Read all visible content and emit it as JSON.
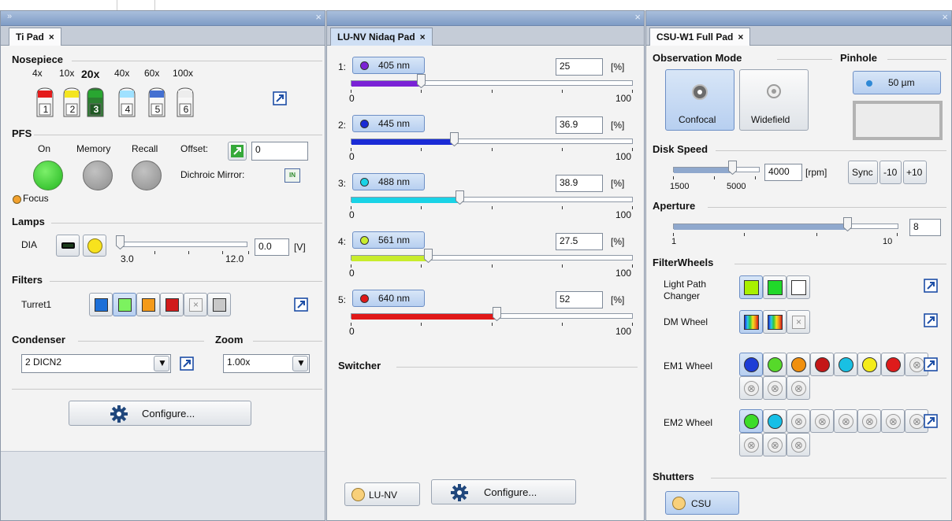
{
  "colors": {
    "header": "#7f9cc6",
    "accent": "#6d8fc5"
  },
  "ti": {
    "tab": "Ti Pad",
    "nosepiece": {
      "title": "Nosepiece",
      "mags": [
        "4x",
        "10x",
        "20x",
        "40x",
        "60x",
        "100x"
      ],
      "slots": [
        "1",
        "2",
        "3",
        "4",
        "5",
        "6"
      ],
      "active_index": 2
    },
    "pfs": {
      "title": "PFS",
      "on": "On",
      "memory": "Memory",
      "recall": "Recall",
      "offset_label": "Offset:",
      "offset_value": "0",
      "dichroic_label": "Dichroic Mirror:",
      "dichroic_badge": "IN",
      "focus": "Focus"
    },
    "lamps": {
      "title": "Lamps",
      "dia": "DIA",
      "min": "3.0",
      "max": "12.0",
      "value": "0.0",
      "unit": "[V]"
    },
    "filters": {
      "title": "Filters",
      "turret": "Turret1"
    },
    "condenser": {
      "title": "Condenser",
      "value": "2 DICN2"
    },
    "zoom": {
      "title": "Zoom",
      "value": "1.00x"
    },
    "configure": "Configure..."
  },
  "lunv": {
    "tab": "LU-NV Nidaq Pad",
    "channels": [
      {
        "idx": "1:",
        "label": "405 nm",
        "value": "25",
        "unit": "[%]",
        "pct": 25,
        "dot": "#7a22d6",
        "fill": "#7a22d6"
      },
      {
        "idx": "2:",
        "label": "445 nm",
        "value": "36.9",
        "unit": "[%]",
        "pct": 36.9,
        "dot": "#1a2bd6",
        "fill": "#1a2bd6"
      },
      {
        "idx": "3:",
        "label": "488 nm",
        "value": "38.9",
        "unit": "[%]",
        "pct": 38.9,
        "dot": "#19d3e6",
        "fill": "#19d3e6"
      },
      {
        "idx": "4:",
        "label": "561 nm",
        "value": "27.5",
        "unit": "[%]",
        "pct": 27.5,
        "dot": "#c8ec2c",
        "fill": "#c8ec2c"
      },
      {
        "idx": "5:",
        "label": "640 nm",
        "value": "52",
        "unit": "[%]",
        "pct": 52,
        "dot": "#e01818",
        "fill": "#e01818"
      }
    ],
    "min": "0",
    "max": "100",
    "switcher": "Switcher",
    "lunv_btn": "LU-NV",
    "configure": "Configure..."
  },
  "csu": {
    "tab": "CSU-W1 Full Pad",
    "observation": {
      "title": "Observation Mode",
      "confocal": "Confocal",
      "widefield": "Widefield"
    },
    "pinhole": {
      "title": "Pinhole",
      "value": "50 µm"
    },
    "disk": {
      "title": "Disk Speed",
      "min": "1500",
      "max": "5000",
      "value": "4000",
      "unit": "[rpm]",
      "sync": "Sync",
      "minus": "-10",
      "plus": "+10"
    },
    "aperture": {
      "title": "Aperture",
      "min": "1",
      "max": "10",
      "value": "8"
    },
    "filterwheels": {
      "title": "FilterWheels",
      "lpc": "Light Path Changer",
      "dm": "DM Wheel",
      "em1": "EM1 Wheel",
      "em2": "EM2 Wheel"
    },
    "shutters": {
      "title": "Shutters",
      "csu": "CSU"
    }
  }
}
